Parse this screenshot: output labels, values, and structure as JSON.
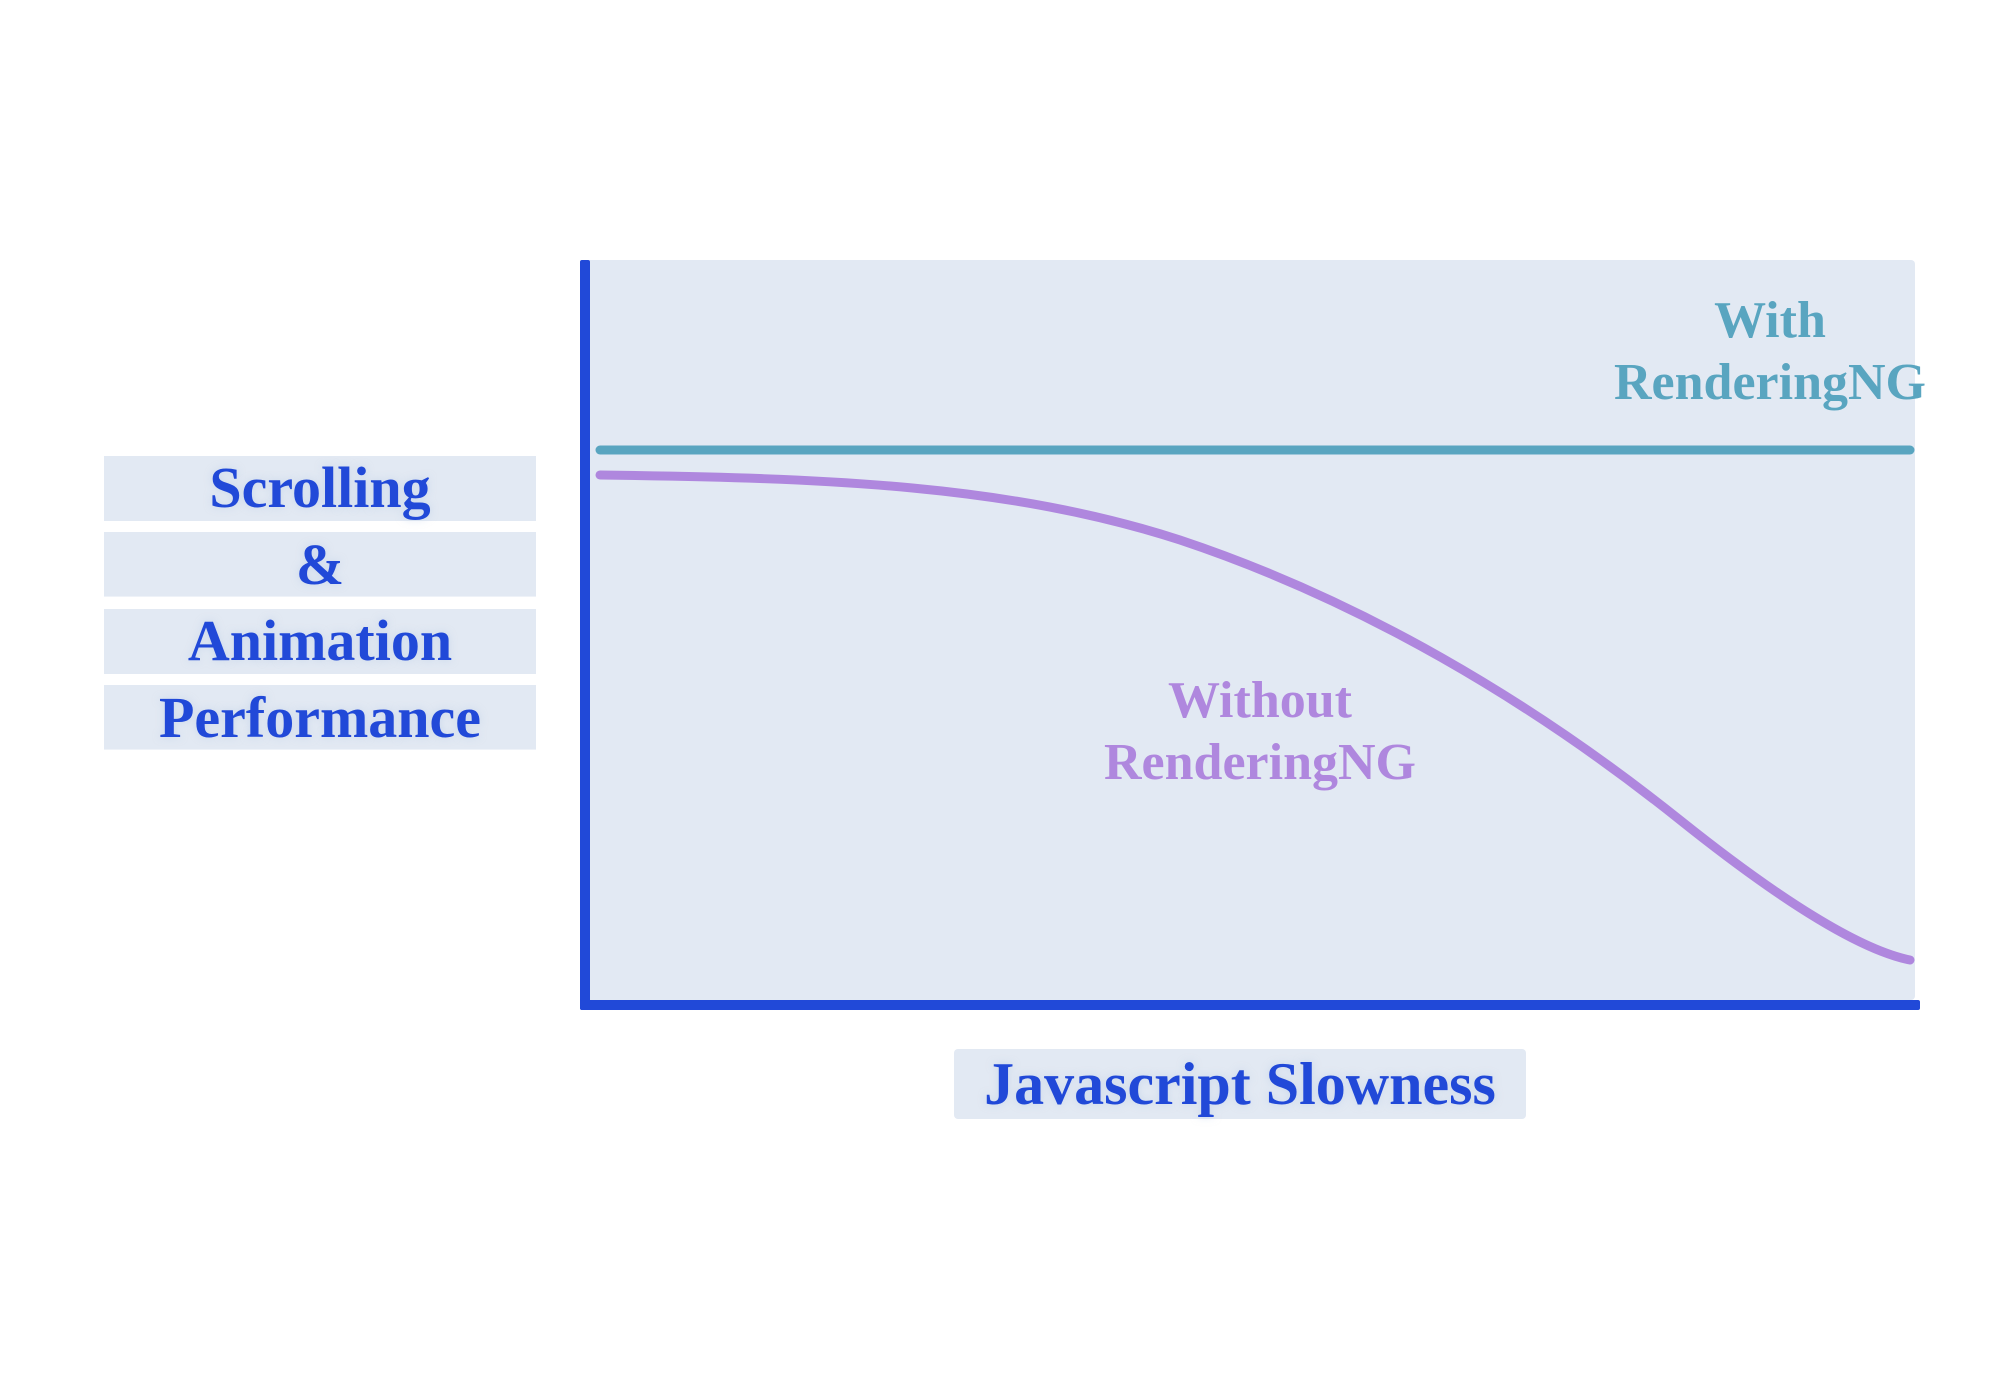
{
  "chart_data": {
    "type": "line",
    "title": "",
    "xlabel": "Javascript Slowness",
    "ylabel": "Scrolling & Animation Performance",
    "xlim": [
      0,
      100
    ],
    "ylim": [
      0,
      100
    ],
    "series": [
      {
        "name": "With RenderingNG",
        "color": "#59a5c0",
        "x": [
          0,
          25,
          50,
          75,
          100
        ],
        "values": [
          75,
          75,
          75,
          75,
          75
        ]
      },
      {
        "name": "Without RenderingNG",
        "color": "#af87de",
        "x": [
          0,
          20,
          40,
          55,
          70,
          80,
          90,
          100
        ],
        "values": [
          72,
          71,
          68,
          62,
          52,
          41,
          28,
          12
        ]
      }
    ]
  },
  "labels": {
    "y_line1": "Scrolling",
    "y_line2": "&",
    "y_line3": "Animation",
    "y_line4": "Performance",
    "x_label": "Javascript Slowness",
    "with_line1": "With",
    "with_line2": "RenderingNG",
    "without_line1": "Without",
    "without_line2": "RenderingNG"
  },
  "colors": {
    "axis": "#2149d8",
    "plot_bg": "#e2e9f3",
    "series_with": "#59a5c0",
    "series_without": "#af87de"
  }
}
